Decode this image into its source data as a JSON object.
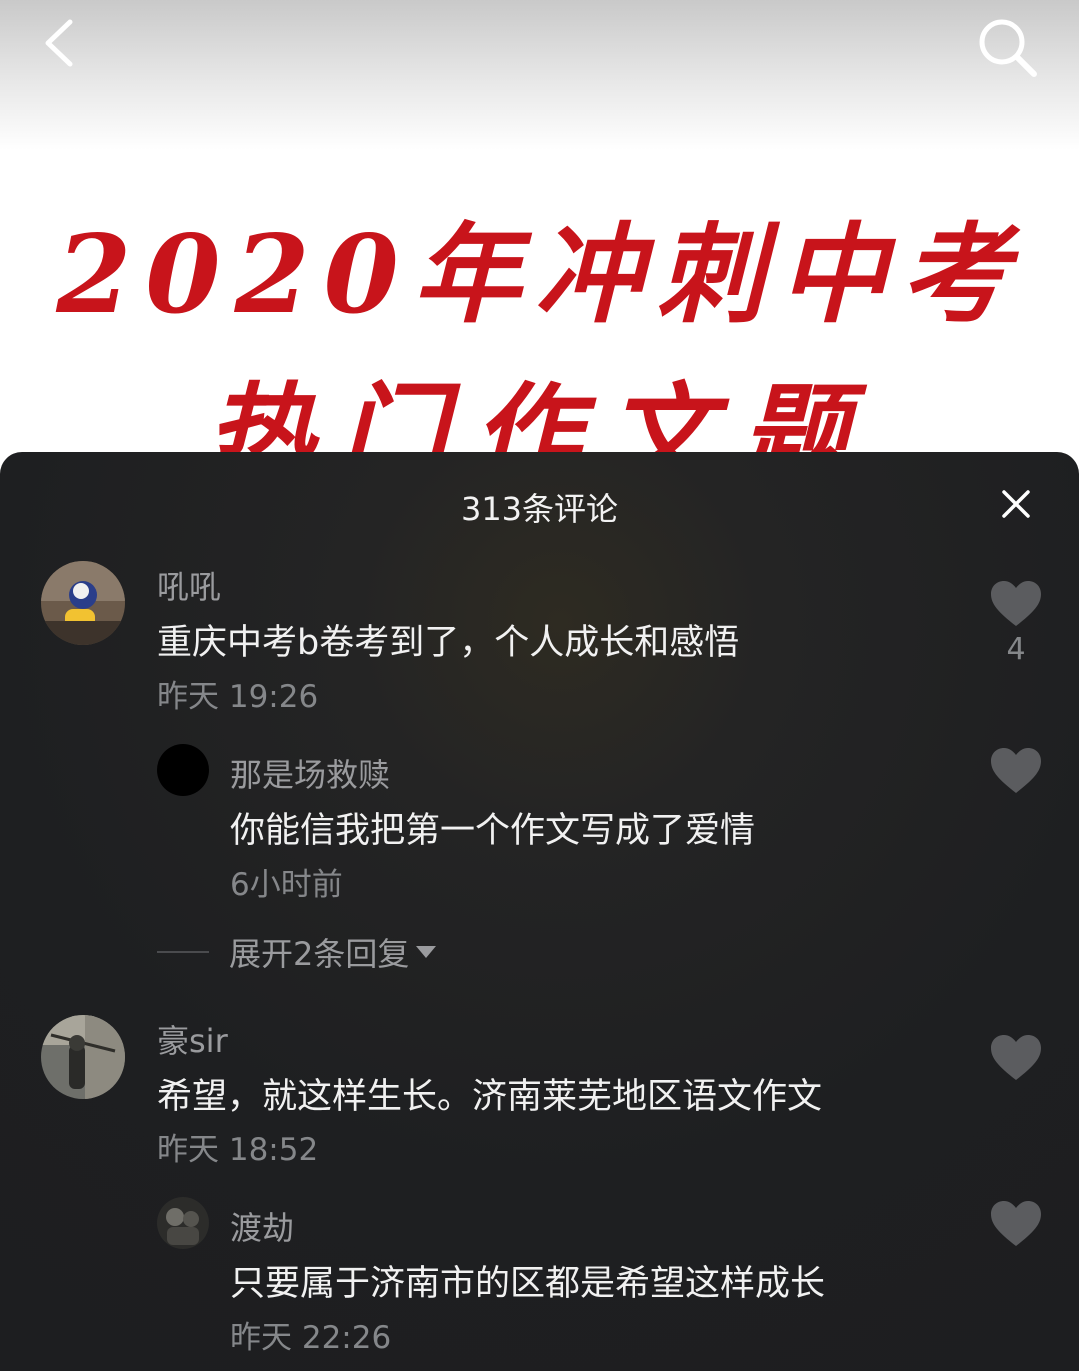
{
  "banner": {
    "line1": "2020年冲刺中考",
    "line2": "热门作文题"
  },
  "panel": {
    "title": "313条评论"
  },
  "comments": [
    {
      "username": "吼吼",
      "text": "重庆中考b卷考到了，个人成长和感悟",
      "time": "昨天 19:26",
      "likes": "4",
      "replies": [
        {
          "username": "那是场救赎",
          "text": "你能信我把第一个作文写成了爱情",
          "time": "6小时前"
        }
      ],
      "expand_label": "展开2条回复"
    },
    {
      "username": "豪sir",
      "text": "希望，就这样生长。济南莱芜地区语文作文",
      "time": "昨天 18:52",
      "replies": [
        {
          "username": "渡劫",
          "text": "只要属于济南市的区都是希望这样成长",
          "time": "昨天 22:26"
        }
      ]
    }
  ],
  "colors": {
    "banner_red": "#c8141b",
    "panel_bg": "#1e1f21"
  }
}
